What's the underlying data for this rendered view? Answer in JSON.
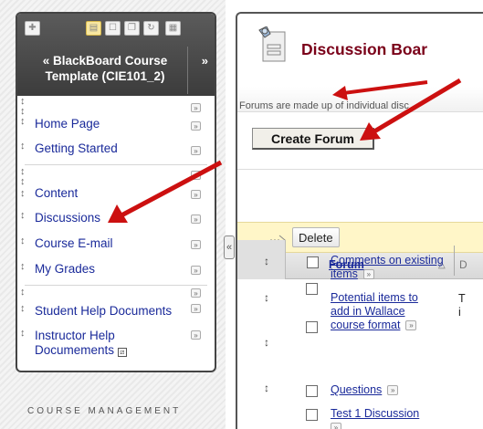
{
  "nav": {
    "toolbar_icons": [
      "add-icon",
      "view-folder-icon",
      "view-list-icon",
      "view-window-icon",
      "refresh-icon",
      "hierarchy-icon"
    ],
    "course_title": "BlackBoard Course Template (CIE101_2)",
    "collapse_glyph": "»",
    "expand_glyph": "«",
    "items": [
      {
        "label": "Home Page"
      },
      {
        "label": "Getting Started"
      },
      {
        "label": "Content"
      },
      {
        "label": "Discussions"
      },
      {
        "label": "Course E-mail"
      },
      {
        "label": "My Grades"
      },
      {
        "label": "Student Help Documents"
      },
      {
        "label": "Instructor Help Documements"
      }
    ],
    "course_management": "COURSE MANAGEMENT"
  },
  "content": {
    "title": "Discussion Boar",
    "description": "Forums are made up of individual disc",
    "create_button": "Create Forum",
    "delete_button": "Delete",
    "table": {
      "column_forum": "Forum",
      "column_cut": "D",
      "rows": [
        {
          "forum": "Comments on existing items",
          "desc": ""
        },
        {
          "forum": "Potential items to add in Wallace course format",
          "desc": "T\ni"
        },
        {
          "forum": "Questions",
          "desc": ""
        },
        {
          "forum": "Test 1 Discussion",
          "desc": ""
        }
      ]
    }
  },
  "colors": {
    "title": "#7a0019",
    "link": "#1a2a9a",
    "arrow": "#cc1010",
    "action_bar": "#fff6c8"
  }
}
